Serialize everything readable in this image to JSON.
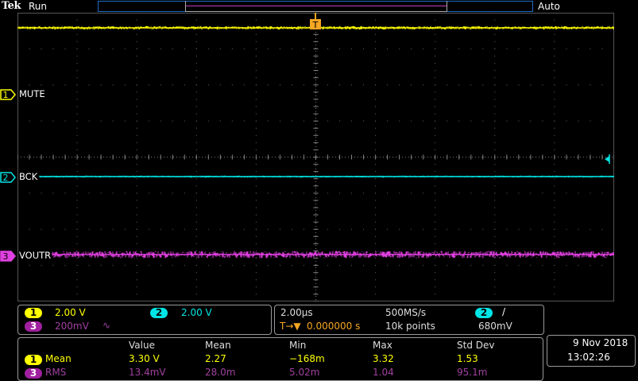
{
  "header": {
    "brand": "Tek",
    "run_state": "Run",
    "trigger_mode": "Auto"
  },
  "channels": [
    {
      "num": "1",
      "label": "MUTE",
      "color": "#ffff00"
    },
    {
      "num": "2",
      "label": "BCK",
      "color": "#00e5e5"
    },
    {
      "num": "3",
      "label": "VOUTR",
      "color": "#e040e0"
    }
  ],
  "trigger_marker": "T",
  "vertical_settings": {
    "ch1": {
      "num": "1",
      "scale": "2.00 V"
    },
    "ch2": {
      "num": "2",
      "scale": "2.00 V"
    },
    "ch3": {
      "num": "3",
      "scale": "200mV",
      "coupling_symbol": "∿"
    }
  },
  "horizontal_settings": {
    "time_per_div": "2.00µs",
    "sample_rate": "500MS/s",
    "trigger_delay_icon": "T→▼",
    "trigger_delay": "0.000000 s",
    "record_length": "10k points",
    "trigger_source": "2",
    "trigger_slope": "/",
    "trigger_level": "680mV"
  },
  "measurements": {
    "headers": {
      "value": "Value",
      "mean": "Mean",
      "min": "Min",
      "max": "Max",
      "std": "Std Dev"
    },
    "rows": [
      {
        "ch": "1",
        "type": "Mean",
        "value": "3.30 V",
        "mean": "2.27",
        "min": "−168m",
        "max": "3.32",
        "std": "1.53"
      },
      {
        "ch": "3",
        "type": "RMS",
        "value": "13.4mV",
        "mean": "28.0m",
        "min": "5.02m",
        "max": "1.04",
        "std": "95.1m"
      }
    ]
  },
  "datetime": {
    "date": "9 Nov 2018",
    "time": "13:02:26"
  }
}
